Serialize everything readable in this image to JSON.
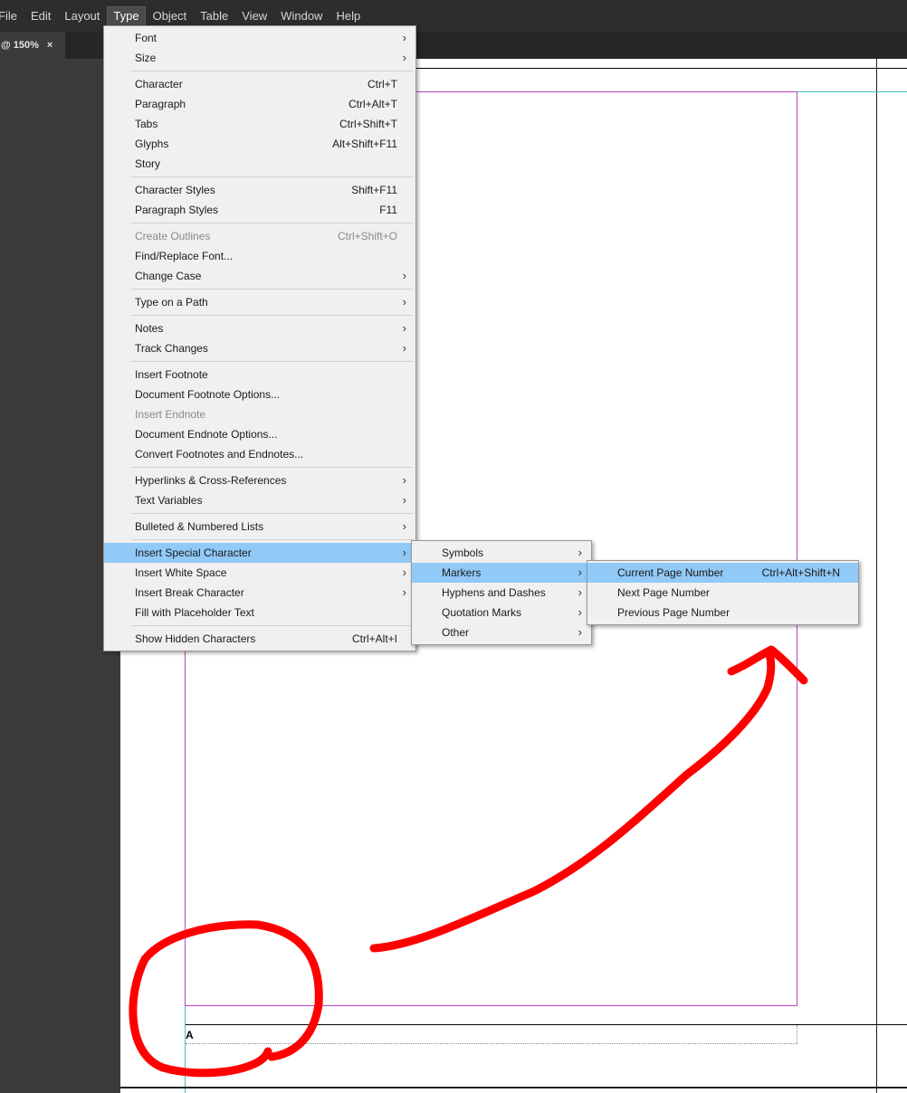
{
  "menubar": {
    "items": [
      "File",
      "Edit",
      "Layout",
      "Type",
      "Object",
      "Table",
      "View",
      "Window",
      "Help"
    ],
    "active": "Type"
  },
  "tab": {
    "label": "@ 150%",
    "close": "×"
  },
  "type_menu": {
    "font": "Font",
    "size": "Size",
    "character": "Character",
    "character_sc": "Ctrl+T",
    "paragraph": "Paragraph",
    "paragraph_sc": "Ctrl+Alt+T",
    "tabs": "Tabs",
    "tabs_sc": "Ctrl+Shift+T",
    "glyphs": "Glyphs",
    "glyphs_sc": "Alt+Shift+F11",
    "story": "Story",
    "character_styles": "Character Styles",
    "character_styles_sc": "Shift+F11",
    "paragraph_styles": "Paragraph Styles",
    "paragraph_styles_sc": "F11",
    "create_outlines": "Create Outlines",
    "create_outlines_sc": "Ctrl+Shift+O",
    "find_replace_font": "Find/Replace Font...",
    "change_case": "Change Case",
    "type_on_path": "Type on a Path",
    "notes": "Notes",
    "track_changes": "Track Changes",
    "insert_footnote": "Insert Footnote",
    "doc_footnote_options": "Document Footnote Options...",
    "insert_endnote": "Insert Endnote",
    "doc_endnote_options": "Document Endnote Options...",
    "convert_footnotes": "Convert Footnotes and Endnotes...",
    "hyperlinks": "Hyperlinks & Cross-References",
    "text_variables": "Text Variables",
    "bulleted_lists": "Bulleted & Numbered Lists",
    "insert_special": "Insert Special Character",
    "insert_white_space": "Insert White Space",
    "insert_break": "Insert Break Character",
    "fill_placeholder": "Fill with Placeholder Text",
    "show_hidden": "Show Hidden Characters",
    "show_hidden_sc": "Ctrl+Alt+I"
  },
  "special_menu": {
    "symbols": "Symbols",
    "markers": "Markers",
    "hyphens": "Hyphens and Dashes",
    "quotation": "Quotation Marks",
    "other": "Other"
  },
  "markers_menu": {
    "current": "Current Page Number",
    "current_sc": "Ctrl+Alt+Shift+N",
    "next": "Next Page Number",
    "previous": "Previous Page Number"
  },
  "frame_text": "A",
  "colors": {
    "highlight": "#91c9f7",
    "margin_guide": "#c040c0",
    "column_guide": "#40c0c0",
    "annotation": "#ff0000"
  }
}
